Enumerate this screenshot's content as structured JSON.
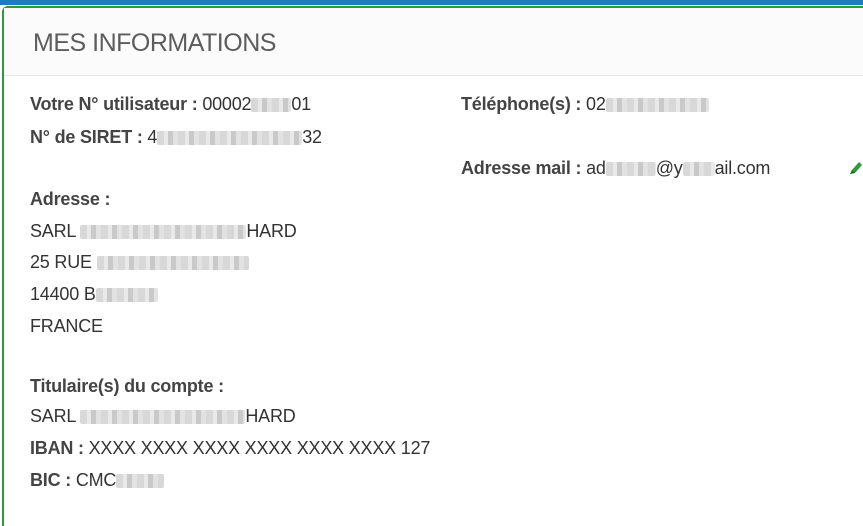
{
  "panel": {
    "title": "MES INFORMATIONS"
  },
  "user": {
    "user_number_label": "Votre N° utilisateur :",
    "user_number_prefix": "00002",
    "user_number_suffix": "01",
    "siret_label": "N° de SIRET :",
    "siret_prefix": "4",
    "siret_suffix": "32",
    "phone_label": "Téléphone(s) :",
    "phone_prefix": "02",
    "email_label": "Adresse mail :",
    "email_part1": "ad",
    "email_part2": "@y",
    "email_part3": "ail.com"
  },
  "address": {
    "label": "Adresse :",
    "line1_prefix": "SARL",
    "line1_suffix": "HARD",
    "line2_prefix": "25 RUE",
    "line3_prefix": "14400 B",
    "country": "FRANCE"
  },
  "account": {
    "label": "Titulaire(s) du compte :",
    "holder_prefix": "SARL",
    "holder_suffix": "HARD",
    "iban_label": "IBAN :",
    "iban_value": "XXXX XXXX XXXX XXXX XXXX XXXX 127",
    "bic_label": "BIC :",
    "bic_prefix": "CMC"
  },
  "icons": {
    "edit": "pencil-icon",
    "accent_color": "#2e9a3a"
  }
}
